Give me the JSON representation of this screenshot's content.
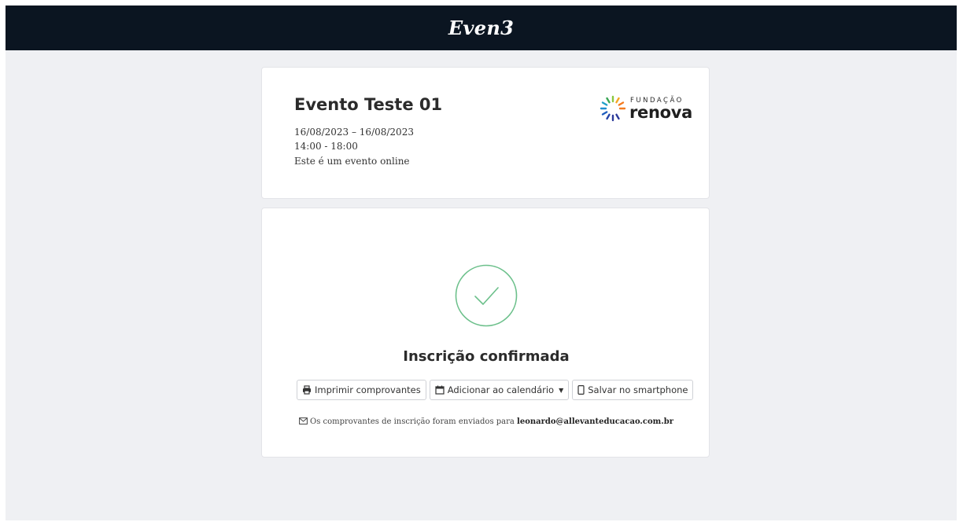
{
  "header": {
    "brand": "Even3"
  },
  "event": {
    "title": "Evento Teste 01",
    "dates": "16/08/2023 – 16/08/2023",
    "time": "14:00 - 18:00",
    "mode": "Este é um evento online",
    "logo": {
      "top_text": "FUNDAÇÃO",
      "main_text": "renova"
    }
  },
  "confirmation": {
    "title": "Inscrição confirmada",
    "buttons": {
      "print": "Imprimir comprovantes",
      "calendar": "Adicionar ao calendário",
      "smartphone": "Salvar no smartphone"
    },
    "note_prefix": "Os comprovantes de inscrição foram enviados para",
    "email": "leonardo@allevanteducacao.com.br"
  },
  "colors": {
    "topbar": "#0b1521",
    "background": "#eff0f3",
    "success": "#6cc08b"
  },
  "icons": {
    "print": "printer-icon",
    "calendar": "calendar-icon",
    "smartphone": "smartphone-icon",
    "mail": "envelope-icon",
    "check": "check-circle-icon"
  }
}
